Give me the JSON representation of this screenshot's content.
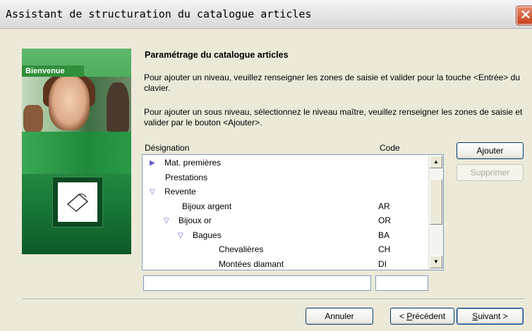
{
  "window": {
    "title": "Assistant de structuration du catalogue articles",
    "close_glyph": "✕"
  },
  "side_panel": {
    "badge": "Bienvenue",
    "logo_icon": "card-logo-icon"
  },
  "content": {
    "heading": "Paramétrage du catalogue articles",
    "para1": "Pour ajouter un niveau, veuillez renseigner les zones de saisie et valider pour la touche <Entrée> du clavier.",
    "para2": "Pour ajouter un sous niveau, sélectionnez le niveau maître, veuillez renseigner les zones de saisie et valider par le bouton <Ajouter>."
  },
  "table": {
    "col_designation": "Désignation",
    "col_code": "Code",
    "rows": [
      {
        "label": "Mat. premières",
        "code": "",
        "level": 0,
        "toggle": "collapsed"
      },
      {
        "label": "Prestations",
        "code": "",
        "level": 0,
        "toggle": "none"
      },
      {
        "label": "Revente",
        "code": "",
        "level": 0,
        "toggle": "expanded"
      },
      {
        "label": "Bijoux argent",
        "code": "AR",
        "level": 1,
        "toggle": "none"
      },
      {
        "label": "Bijoux or",
        "code": "OR",
        "level": 1,
        "toggle": "expanded"
      },
      {
        "label": "Bagues",
        "code": "BA",
        "level": 2,
        "toggle": "expanded"
      },
      {
        "label": "Chevalières",
        "code": "CH",
        "level": 3,
        "toggle": "none"
      },
      {
        "label": "Montées diamant",
        "code": "DI",
        "level": 3,
        "toggle": "none"
      }
    ]
  },
  "inputs": {
    "designation_value": "",
    "code_value": ""
  },
  "buttons": {
    "add": "Ajouter",
    "remove": "Supprimer",
    "cancel": "Annuler",
    "prev_prefix": "< ",
    "prev_mnemonic": "P",
    "prev_rest": "récédent",
    "next_mnemonic": "S",
    "next_rest": "uivant >"
  },
  "colors": {
    "tree_arrow": "#5a5ad0",
    "accent_green": "#2f8f3a",
    "close_red": "#c8401e"
  }
}
